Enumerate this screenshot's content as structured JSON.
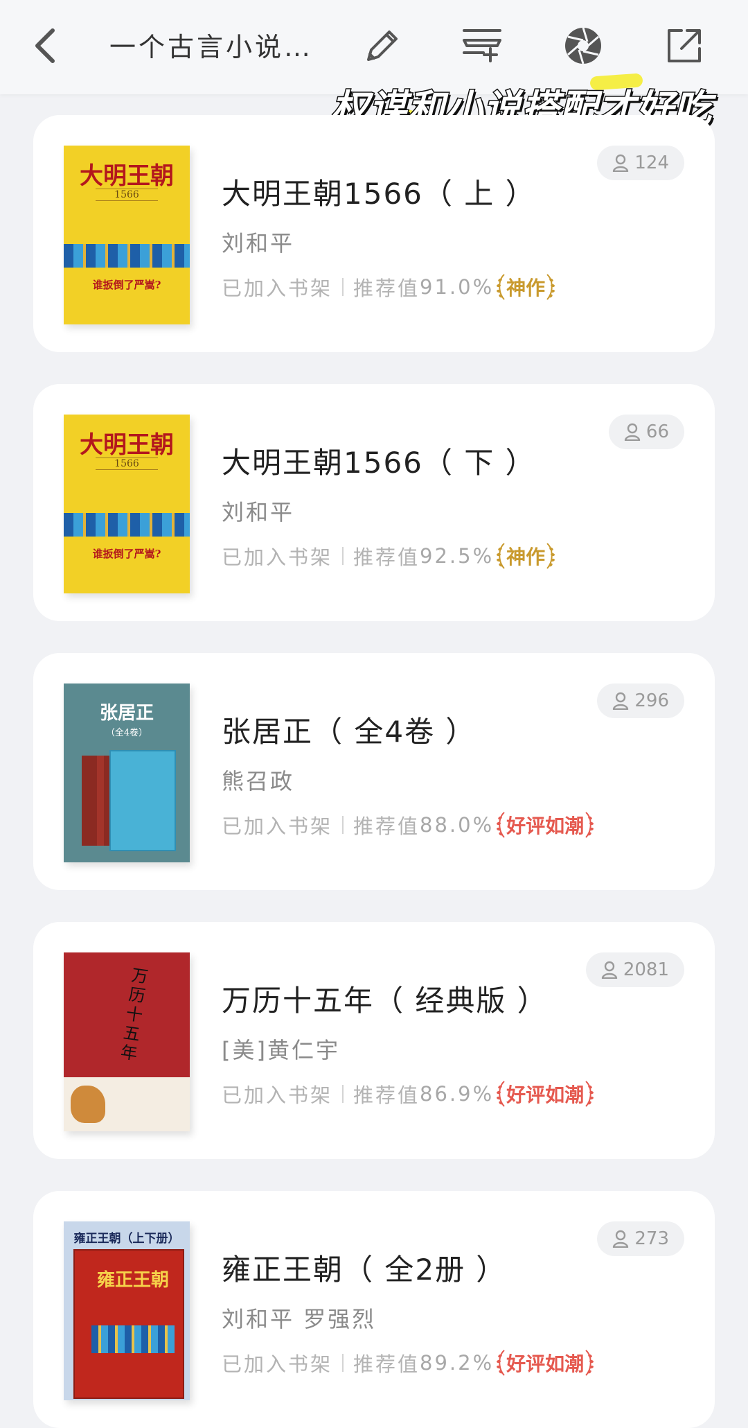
{
  "header": {
    "title": "一个古言小说…",
    "icons": [
      "back-icon",
      "edit-icon",
      "add-list-icon",
      "aperture-icon",
      "share-icon"
    ]
  },
  "overlay_caption": "权谋和小说搭配才好吃",
  "shelf_label": "已加入书架",
  "score_label": "推荐值",
  "books": [
    {
      "title": "大明王朝1566（ 上 ）",
      "author": "刘和平",
      "score": "91.0%",
      "badge": "神作",
      "badge_color": "#c99a2e",
      "readers": "124",
      "cover": {
        "title": "大明王朝",
        "sub": "1566",
        "tagline": "谁扳倒了严嵩?",
        "bg": "#f2d026",
        "fg": "#b3171d"
      }
    },
    {
      "title": "大明王朝1566（ 下 ）",
      "author": "刘和平",
      "score": "92.5%",
      "badge": "神作",
      "badge_color": "#c99a2e",
      "readers": "66",
      "cover": {
        "title": "大明王朝",
        "sub": "1566",
        "tagline": "谁扳倒了严嵩?",
        "bg": "#f2d026",
        "fg": "#b3171d"
      }
    },
    {
      "title": "张居正（ 全4卷 ）",
      "author": "熊召政",
      "score": "88.0%",
      "badge": "好评如潮",
      "badge_color": "#e5594f",
      "readers": "296",
      "cover": {
        "title": "张居正",
        "sub": "（全4卷）",
        "bg": "#5b8a90",
        "fg": "#ffffff"
      }
    },
    {
      "title": "万历十五年（ 经典版 ）",
      "author": "[美]黄仁宇",
      "score": "86.9%",
      "badge": "好评如潮",
      "badge_color": "#e5594f",
      "readers": "2081",
      "cover": {
        "title": "万历十五年",
        "bg": "#b0272b",
        "fg": "#111111"
      }
    },
    {
      "title": "雍正王朝（ 全2册 ）",
      "author": "刘和平  罗强烈",
      "score": "89.2%",
      "badge": "好评如潮",
      "badge_color": "#e5594f",
      "readers": "273",
      "cover": {
        "title": "雍正王朝（上下册）",
        "inner": "雍正王朝",
        "bg": "#c8d7ea",
        "fg": "#c0271d"
      }
    }
  ]
}
